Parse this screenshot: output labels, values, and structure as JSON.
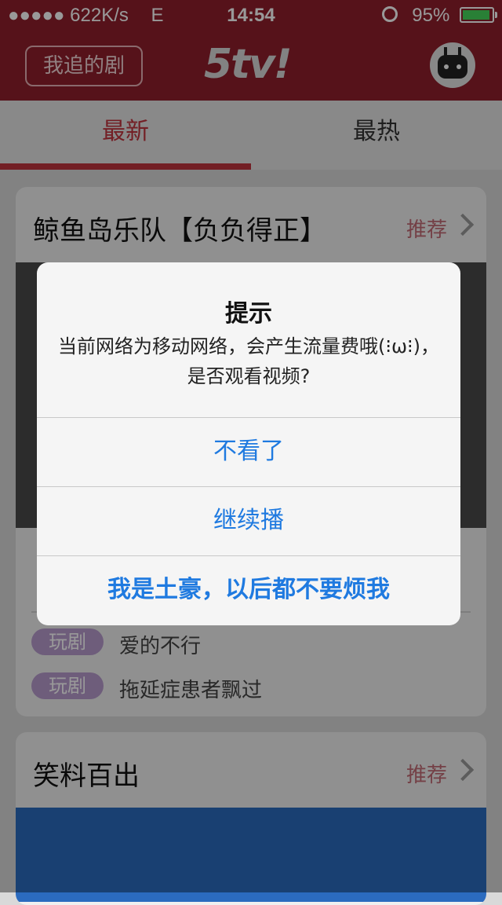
{
  "status_bar": {
    "signal": "●●●●● 622K/s",
    "network": "E",
    "time": "14:54",
    "battery": "95%",
    "battery_level": 0.95
  },
  "header": {
    "follow_button": "我追的剧",
    "logo": "5tv!",
    "avatar_icon": "tv-robot-avatar"
  },
  "tabs": [
    {
      "label": "最新",
      "active": true
    },
    {
      "label": "最热",
      "active": false
    }
  ],
  "feed": {
    "card1": {
      "title": "鲸鱼岛乐队【负负得正】",
      "recommend": "推荐",
      "items": [
        {
          "tag": "玩剧",
          "text": "爱的不行"
        },
        {
          "tag": "玩剧",
          "text": "拖延症患者飘过"
        }
      ]
    },
    "card2": {
      "title": "笑料百出",
      "recommend": "推荐"
    }
  },
  "alert": {
    "title": "提示",
    "message": "当前网络为移动网络，会产生流量费哦(⁝ω⁝)，是否观看视频?",
    "buttons": [
      "不看了",
      "继续播",
      "我是土豪，以后都不要烦我"
    ]
  },
  "colors": {
    "brand": "#8f1f2c",
    "accent": "#c0343f",
    "link": "#1f7ae0",
    "tag": "#b79cce"
  }
}
